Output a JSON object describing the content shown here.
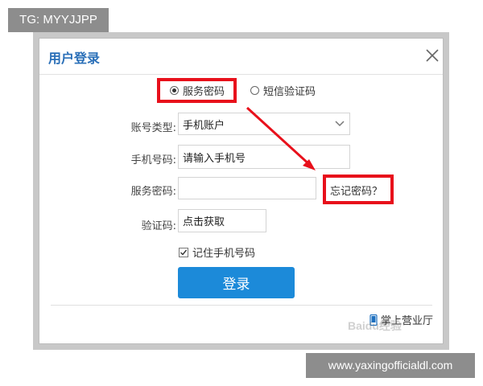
{
  "overlays": {
    "tg_label": "TG: MYYJJPP",
    "site_url": "www.yaxingofficialdl.com"
  },
  "dialog": {
    "title": "用户登录",
    "close_icon": "close-icon",
    "tabs": [
      {
        "label": "服务密码",
        "selected": true
      },
      {
        "label": "短信验证码",
        "selected": false
      }
    ],
    "account_type": {
      "label": "账号类型:",
      "value": "手机账户"
    },
    "phone": {
      "label": "手机号码:",
      "placeholder": "请输入手机号"
    },
    "password": {
      "label": "服务密码:",
      "value": ""
    },
    "forgot_password": "忘记密码？",
    "captcha": {
      "label": "验证码:",
      "value": "点击获取"
    },
    "remember": {
      "label": "记住手机号码",
      "checked": true
    },
    "login_button": "登录",
    "hall_link": "掌上营业厅",
    "watermark": "Baidu经验"
  },
  "colors": {
    "title_blue": "#2a6fb8",
    "button_blue": "#1c8ad9",
    "highlight_red": "#e8101b"
  }
}
